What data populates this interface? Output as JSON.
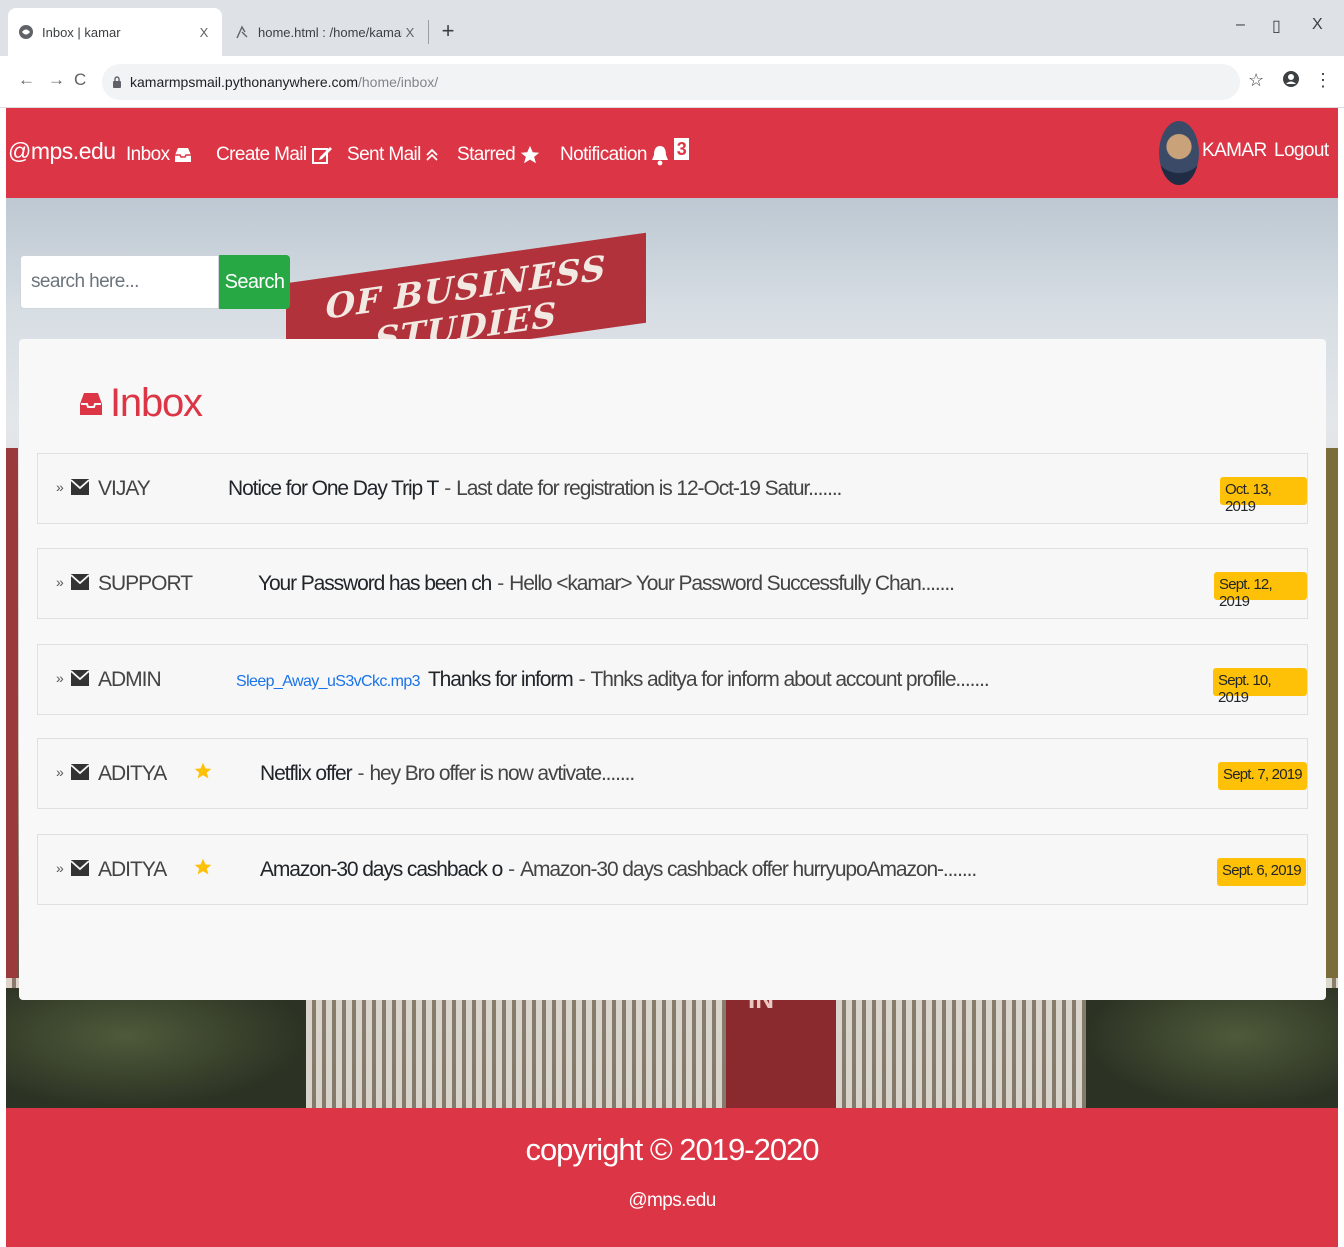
{
  "browser": {
    "tabs": [
      {
        "title": "Inbox | kamar",
        "close": "X"
      },
      {
        "title": "home.html : /home/kamarmpsm",
        "close": "X"
      }
    ],
    "new_tab": "+",
    "window_controls": {
      "minimize": "–",
      "maximize": "▯",
      "close": "X"
    },
    "nav": {
      "back": "←",
      "forward": "→",
      "reload": "C"
    },
    "url_host": "kamarmpsmail.pythonanywhere.com",
    "url_path": "/home/inbox/",
    "toolbar_icons": [
      "star-icon",
      "account-icon",
      "menu-icon"
    ],
    "kebab": "⋮"
  },
  "nav": {
    "brand": "@mps.edu",
    "links": {
      "inbox": "Inbox",
      "create": "Create Mail",
      "sent": "Sent Mail",
      "starred": "Starred",
      "notification": "Notification"
    },
    "notification_count": "3",
    "user": "KAMAR",
    "logout": "Logout"
  },
  "background": {
    "banner": "OF BUSINESS STUDIES",
    "building_sign": "IN"
  },
  "search": {
    "placeholder": "search here...",
    "button": "Search"
  },
  "inbox": {
    "heading": "Inbox",
    "mails": [
      {
        "sender": "VIJAY",
        "starred": false,
        "attachment": "",
        "subject": "Notice for One Day Trip T",
        "preview": "Last date for registration is 12-Oct-19 Satur.......",
        "date": "Oct. 13, 2019"
      },
      {
        "sender": "SUPPORT",
        "starred": false,
        "attachment": "",
        "subject": "Your Password has been ch",
        "preview": "Hello <kamar> Your Password Successfully Chan.......",
        "date": "Sept. 12, 2019"
      },
      {
        "sender": "ADMIN",
        "starred": false,
        "attachment": "Sleep_Away_uS3vCkc.mp3",
        "subject": "Thanks for inform",
        "preview": "Thnks aditya for inform about account profile.......",
        "date": "Sept. 10, 2019"
      },
      {
        "sender": "ADITYA",
        "starred": true,
        "attachment": "",
        "subject": "Netflix offer",
        "preview": "hey Bro offer is now avtivate.......",
        "date": "Sept. 7, 2019"
      },
      {
        "sender": "ADITYA",
        "starred": true,
        "attachment": "",
        "subject": "Amazon-30 days cashback o",
        "preview": "Amazon-30 days cashback offer hurryupoAmazon-.......",
        "date": "Sept. 6, 2019"
      }
    ],
    "separator": "-",
    "chevron": "»"
  },
  "footer": {
    "copyright": "copyright © 2019-2020",
    "brand": "@mps.edu"
  },
  "colors": {
    "primary": "#dc3545",
    "success": "#28a745",
    "warning": "#ffc107",
    "link": "#1a73e8"
  }
}
